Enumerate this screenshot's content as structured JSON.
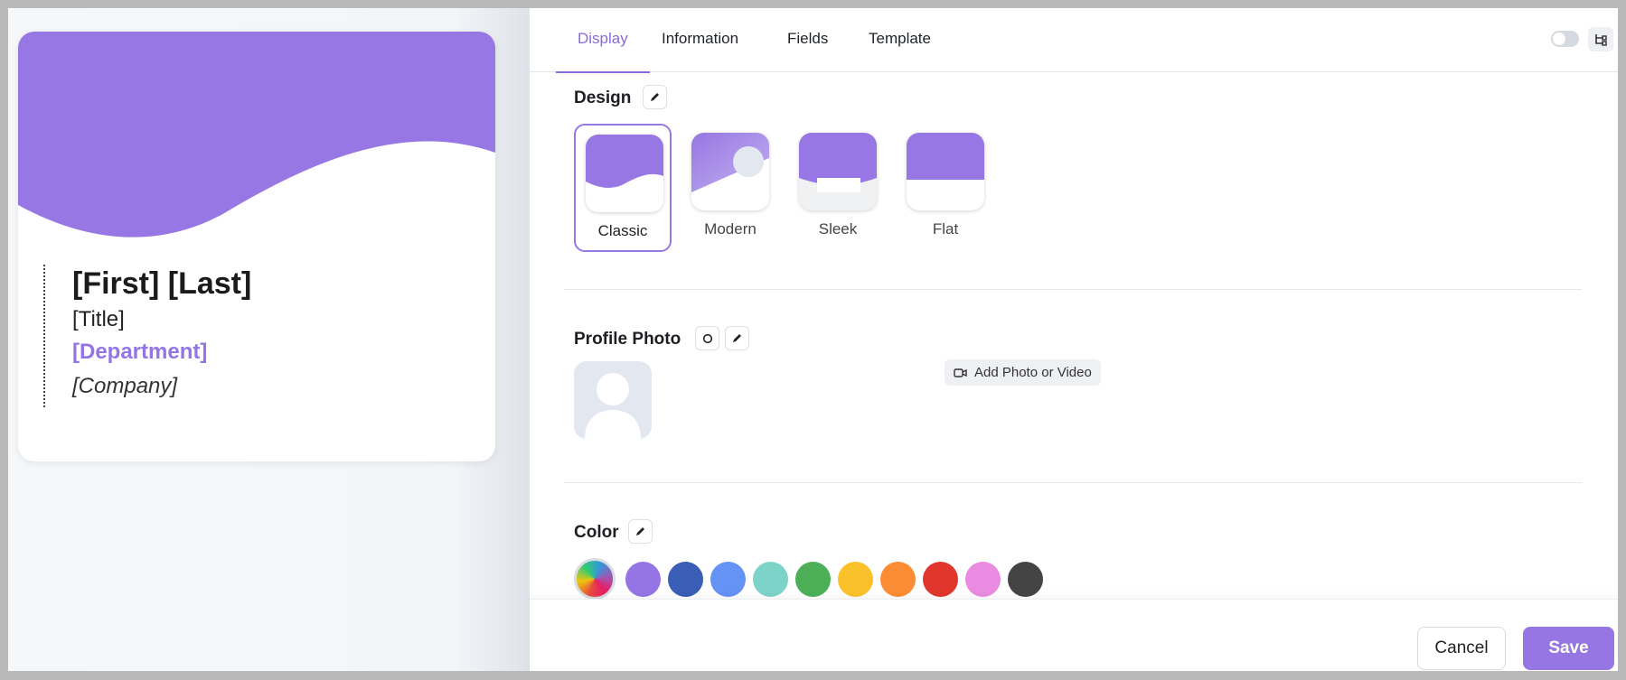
{
  "card": {
    "name": "[First] [Last]",
    "title": "[Title]",
    "department": "[Department]",
    "company": "[Company]",
    "accent_color": "#9575e5"
  },
  "tabs": [
    {
      "label": "Display",
      "active": true
    },
    {
      "label": "Information",
      "active": false
    },
    {
      "label": "Fields",
      "active": false
    },
    {
      "label": "Template",
      "active": false
    }
  ],
  "sections": {
    "design": {
      "label": "Design",
      "options": [
        {
          "label": "Classic",
          "selected": true
        },
        {
          "label": "Modern",
          "selected": false
        },
        {
          "label": "Sleek",
          "selected": false
        },
        {
          "label": "Flat",
          "selected": false
        }
      ]
    },
    "profile_photo": {
      "label": "Profile Photo",
      "add_button_label": "Add Photo or Video"
    },
    "color": {
      "label": "Color",
      "swatches": [
        "#9575e5",
        "#3a5eb5",
        "#6492f5",
        "#7dd3c8",
        "#4caf58",
        "#fbc12a",
        "#fc8d35",
        "#e0362c",
        "#ea8ae0",
        "#444444"
      ]
    }
  },
  "footer": {
    "cancel_label": "Cancel",
    "save_label": "Save"
  }
}
